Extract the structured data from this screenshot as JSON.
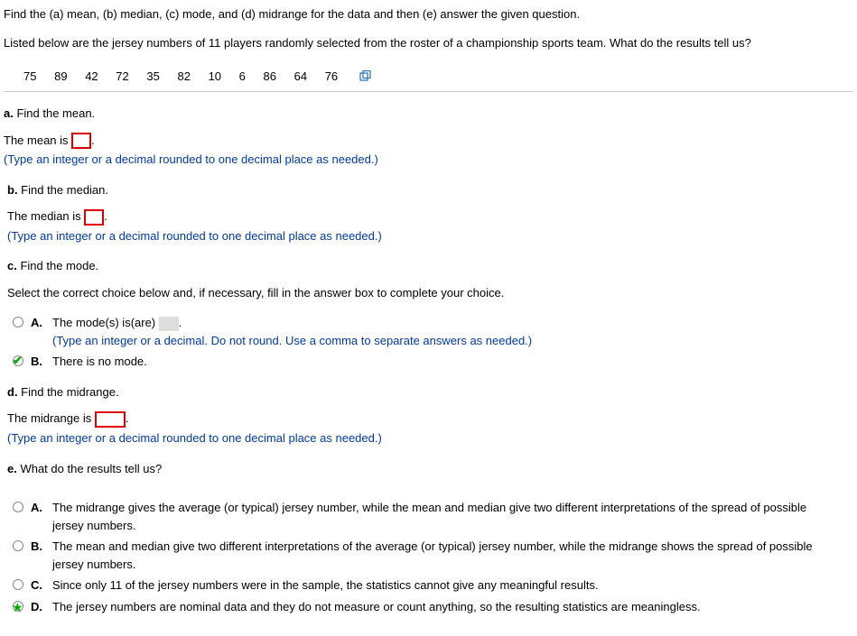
{
  "intro": "Find the (a) mean, (b) median, (c) mode, and (d) midrange for the data and then (e) answer the given question.",
  "question": "Listed below are the jersey numbers of 11 players randomly selected from the roster of a championship sports team. What do the results tell us?",
  "data_values": [
    "75",
    "89",
    "42",
    "72",
    "35",
    "82",
    "10",
    "6",
    "86",
    "64",
    "76"
  ],
  "icons": {
    "copy": "copy-icon"
  },
  "partA": {
    "label_prefix": "a.",
    "label_text": " Find the mean.",
    "answer_prefix": "The mean is ",
    "answer_suffix": ".",
    "hint": "(Type an integer or a decimal rounded to one decimal place as needed.)"
  },
  "partB": {
    "label_prefix": "b.",
    "label_text": " Find the median.",
    "answer_prefix": "The median is ",
    "answer_suffix": ".",
    "hint": "(Type an integer or a decimal rounded to one decimal place as needed.)"
  },
  "partC": {
    "label_prefix": "c.",
    "label_text": " Find the mode.",
    "instruction": "Select the correct choice below and, if necessary, fill in the answer box to complete your choice.",
    "optA": {
      "letter": "A.",
      "text_prefix": "The mode(s) is(are) ",
      "text_suffix": ".",
      "hint": "(Type an integer or a decimal. Do not round. Use a comma to separate answers as needed.)"
    },
    "optB": {
      "letter": "B.",
      "text": "There is no mode."
    }
  },
  "partD": {
    "label_prefix": "d.",
    "label_text": " Find the midrange.",
    "answer_prefix": "The midrange is ",
    "answer_suffix": ".",
    "hint": "(Type an integer or a decimal rounded to one decimal place as needed.)"
  },
  "partE": {
    "label_prefix": "e.",
    "label_text": " What do the results tell us?",
    "optA": {
      "letter": "A.",
      "text": "The midrange gives the average (or typical) jersey number, while the mean and median give two different interpretations of the spread of possible jersey numbers."
    },
    "optB": {
      "letter": "B.",
      "text": "The mean and median give two different interpretations of the average (or typical) jersey number, while the midrange shows the spread of possible jersey numbers."
    },
    "optC": {
      "letter": "C.",
      "text": "Since only 11 of the jersey numbers were in the sample, the statistics cannot give any meaningful results."
    },
    "optD": {
      "letter": "D.",
      "text": "The jersey numbers are nominal data and they do not measure or count anything, so the resulting statistics are meaningless."
    }
  }
}
